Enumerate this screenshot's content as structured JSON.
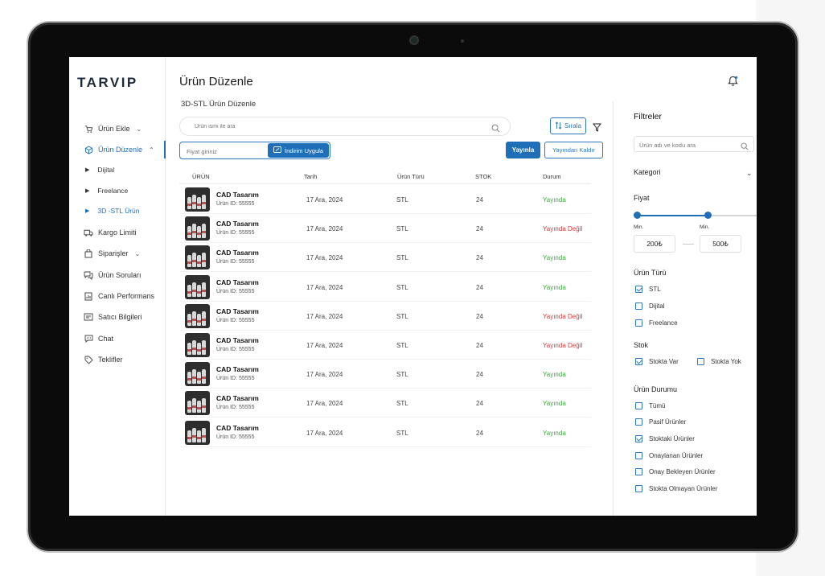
{
  "app": {
    "logo": "TARVIP"
  },
  "header": {
    "title": "Ürün Düzenle",
    "subtitle": "3D-STL Ürün Düzenle"
  },
  "sidebar": {
    "items": [
      {
        "label": "Ürün Ekle",
        "icon": "cart-icon",
        "chevron": "down"
      },
      {
        "label": "Ürün Düzenle",
        "icon": "cube-icon",
        "chevron": "up",
        "active": true
      },
      {
        "label": "Kargo Limiti",
        "icon": "truck-icon"
      },
      {
        "label": "Siparişler",
        "icon": "bag-icon",
        "chevron": "down"
      },
      {
        "label": "Ürün Soruları",
        "icon": "chat-bubbles-icon"
      },
      {
        "label": "Canlı Performans",
        "icon": "chart-doc-icon"
      },
      {
        "label": "Satıcı Bilgileri",
        "icon": "id-card-icon"
      },
      {
        "label": "Chat",
        "icon": "message-icon"
      },
      {
        "label": "Teklifler",
        "icon": "tag-icon"
      }
    ],
    "subitems": [
      {
        "label": "Dijital"
      },
      {
        "label": "Freelance"
      },
      {
        "label": "3D -STL Ürün",
        "active": true
      }
    ]
  },
  "toolbar": {
    "search_placeholder": "Ürün ismi ile ara",
    "sort_label": "Sırala",
    "price_placeholder": "Fiyat giriniz",
    "discount_label": "İndirim Uygula",
    "publish_label": "Yayınla",
    "unpublish_label": "Yayından Kaldır"
  },
  "table": {
    "columns": [
      "ÜRÜN",
      "Tarih",
      "Ürün Türü",
      "STOK",
      "Durum"
    ],
    "rows": [
      {
        "name": "CAD Tasarım",
        "id": "Ürün ID: 55555",
        "date": "17 Ara, 2024",
        "type": "STL",
        "stock": "24",
        "status": "Yayında",
        "published": true
      },
      {
        "name": "CAD Tasarım",
        "id": "Ürün ID: 55555",
        "date": "17 Ara, 2024",
        "type": "STL",
        "stock": "24",
        "status": "Yayında Değil",
        "published": false
      },
      {
        "name": "CAD Tasarım",
        "id": "Ürün ID: 55555",
        "date": "17 Ara, 2024",
        "type": "STL",
        "stock": "24",
        "status": "Yayında",
        "published": true
      },
      {
        "name": "CAD Tasarım",
        "id": "Ürün ID: 55555",
        "date": "17 Ara, 2024",
        "type": "STL",
        "stock": "24",
        "status": "Yayında",
        "published": true
      },
      {
        "name": "CAD Tasarım",
        "id": "Ürün ID: 55555",
        "date": "17 Ara, 2024",
        "type": "STL",
        "stock": "24",
        "status": "Yayında Değil",
        "published": false
      },
      {
        "name": "CAD Tasarım",
        "id": "Ürün ID: 55555",
        "date": "17 Ara, 2024",
        "type": "STL",
        "stock": "24",
        "status": "Yayında Değil",
        "published": false
      },
      {
        "name": "CAD Tasarım",
        "id": "Ürün ID: 55555",
        "date": "17 Ara, 2024",
        "type": "STL",
        "stock": "24",
        "status": "Yayında",
        "published": true
      },
      {
        "name": "CAD Tasarım",
        "id": "Ürün ID: 55555",
        "date": "17 Ara, 2024",
        "type": "STL",
        "stock": "24",
        "status": "Yayında",
        "published": true
      },
      {
        "name": "CAD Tasarım",
        "id": "Ürün ID: 55555",
        "date": "17 Ara, 2024",
        "type": "STL",
        "stock": "24",
        "status": "Yayında",
        "published": true
      }
    ]
  },
  "filters": {
    "title": "Filtreler",
    "search_placeholder": "Ürün adı ve kodu ara",
    "category_label": "Kategori",
    "price_label": "Fiyat",
    "price": {
      "min_label": "Min.",
      "max_label": "Min.",
      "min_value": "200₺",
      "max_value": "500₺"
    },
    "type_label": "Ürün Türü",
    "types": [
      {
        "label": "STL",
        "checked": true
      },
      {
        "label": "Dijital",
        "checked": false
      },
      {
        "label": "Freelance",
        "checked": false
      }
    ],
    "stock_label": "Stok",
    "stock": [
      {
        "label": "Stokta Var",
        "checked": true
      },
      {
        "label": "Stokta Yok",
        "checked": false
      }
    ],
    "status_label": "Ürün Durumu",
    "statuses": [
      {
        "label": "Tümü",
        "checked": false
      },
      {
        "label": "Pasif Ürünler",
        "checked": false
      },
      {
        "label": "Stoktaki Ürünler",
        "checked": true
      },
      {
        "label": "Onaylanan Ürünler",
        "checked": false
      },
      {
        "label": "Onay Bekleyen Ürünler",
        "checked": false
      },
      {
        "label": "Stokta Olmayan Ürünler",
        "checked": false
      }
    ]
  },
  "colors": {
    "accent": "#1f6fb8",
    "published": "#3aa83a",
    "unpublished": "#d63a3a"
  }
}
